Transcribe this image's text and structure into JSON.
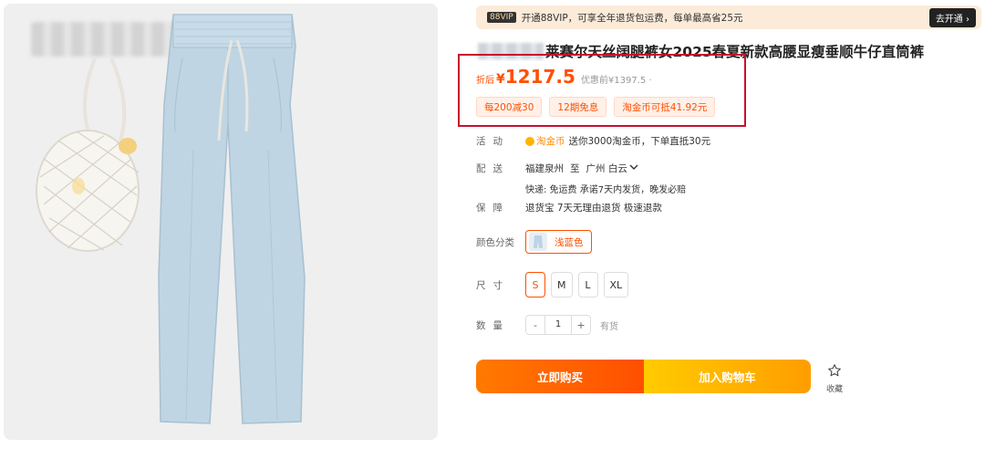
{
  "vip": {
    "badge": "88VIP",
    "text": "开通88VIP，可享全年退货包运费，每单最高省25元",
    "button": "去开通 ›"
  },
  "product": {
    "title": "莱赛尔天丝阔腿裤女2025春夏新款高腰显瘦垂顺牛仔直筒裤",
    "price_prefix": "折后",
    "currency": "¥",
    "price": "1217.5",
    "original_price": "优惠前¥1397.5 ·",
    "promos": [
      "每200减30",
      "12期免息",
      "淘金币可抵41.92元"
    ]
  },
  "activity": {
    "label": "活动",
    "coin_name": "淘金币",
    "text": "送你3000淘金币，下单直抵30元"
  },
  "delivery": {
    "label": "配送",
    "from": "福建泉州",
    "to_word": "至",
    "to": "广州 白云",
    "detail": "快递: 免运费  承诺7天内发货，晚发必赔"
  },
  "guarantee": {
    "label": "保障",
    "text": "退货宝 7天无理由退货 极速退款"
  },
  "color": {
    "label": "颜色分类",
    "selected": "浅蓝色"
  },
  "size": {
    "label": "尺寸",
    "options": [
      "S",
      "M",
      "L",
      "XL"
    ],
    "selected": "S"
  },
  "quantity": {
    "label": "数量",
    "minus": "-",
    "value": "1",
    "plus": "+",
    "stock": "有货"
  },
  "actions": {
    "buy": "立即购买",
    "cart": "加入购物车",
    "favorite": "收藏"
  },
  "colors": {
    "accent": "#ff5000",
    "highlight_box": "#c8102e",
    "vip_bg": "#fcebd9"
  }
}
